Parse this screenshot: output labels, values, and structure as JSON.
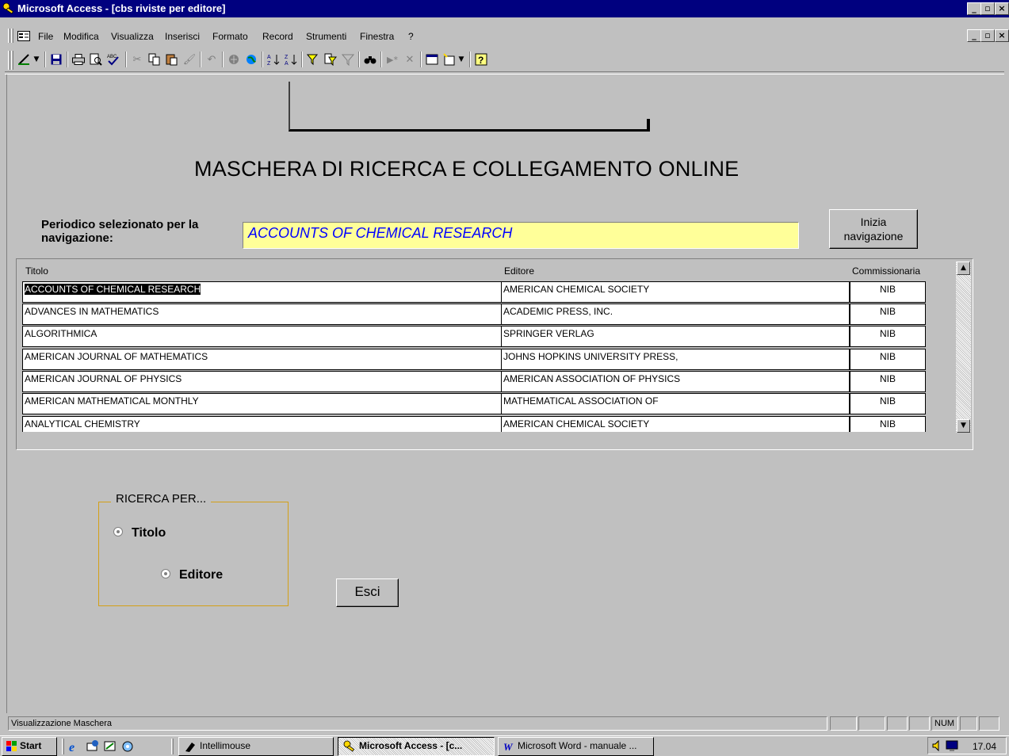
{
  "window": {
    "title": "Microsoft Access - [cbs riviste per editore]"
  },
  "menu": [
    "File",
    "Modifica",
    "Visualizza",
    "Inserisci",
    "Formato",
    "Record",
    "Strumenti",
    "Finestra",
    "?"
  ],
  "toolbar": {
    "icons": [
      "design-view-icon",
      "save-icon",
      "print-icon",
      "print-preview-icon",
      "spelling-icon",
      "cut-icon",
      "copy-icon",
      "paste-icon",
      "format-painter-icon",
      "undo-icon",
      "insert-hyperlink-icon",
      "web-toolbar-icon",
      "sort-ascending-icon",
      "sort-descending-icon",
      "filter-by-selection-icon",
      "filter-by-form-icon",
      "apply-filter-icon",
      "find-icon",
      "new-record-icon",
      "delete-record-icon",
      "database-window-icon",
      "new-object-icon",
      "help-icon"
    ]
  },
  "form": {
    "title": "MASCHERA DI RICERCA E COLLEGAMENTO ONLINE",
    "selected_label": "Periodico selezionato per la navigazione:",
    "selected_value": "ACCOUNTS OF CHEMICAL RESEARCH",
    "start_button": "Inizia navigazione",
    "exit_button": "Esci",
    "search_group": "RICERCA PER...",
    "radio_title": "Titolo",
    "radio_publisher": "Editore"
  },
  "table": {
    "headers": {
      "title": "Titolo",
      "publisher": "Editore",
      "agent": "Commissionaria"
    },
    "rows": [
      {
        "title": "ACCOUNTS OF CHEMICAL RESEARCH",
        "publisher": "AMERICAN CHEMICAL SOCIETY",
        "agent": "NIB"
      },
      {
        "title": "ADVANCES IN MATHEMATICS",
        "publisher": "ACADEMIC PRESS, INC.",
        "agent": "NIB"
      },
      {
        "title": "ALGORITHMICA",
        "publisher": "SPRINGER VERLAG",
        "agent": "NIB"
      },
      {
        "title": "AMERICAN JOURNAL OF MATHEMATICS",
        "publisher": "JOHNS HOPKINS UNIVERSITY PRESS,",
        "agent": "NIB"
      },
      {
        "title": "AMERICAN JOURNAL OF PHYSICS",
        "publisher": "AMERICAN ASSOCIATION OF PHYSICS",
        "agent": "NIB"
      },
      {
        "title": "AMERICAN MATHEMATICAL MONTHLY",
        "publisher": "MATHEMATICAL ASSOCIATION OF",
        "agent": "NIB"
      },
      {
        "title": "ANALYTICAL CHEMISTRY",
        "publisher": "AMERICAN CHEMICAL SOCIETY",
        "agent": "NIB"
      }
    ]
  },
  "statusbar": {
    "text": "Visualizzazione Maschera",
    "num": "NUM"
  },
  "taskbar": {
    "start": "Start",
    "items": [
      "Intellimouse",
      "Microsoft Access - [c...",
      "Microsoft Word - manuale ..."
    ],
    "clock": "17.04"
  },
  "colors": {
    "titlebar": "#00007f",
    "highlight_field": "#ffff99",
    "link_text": "#0000ff",
    "group_border": "#d4a017"
  }
}
